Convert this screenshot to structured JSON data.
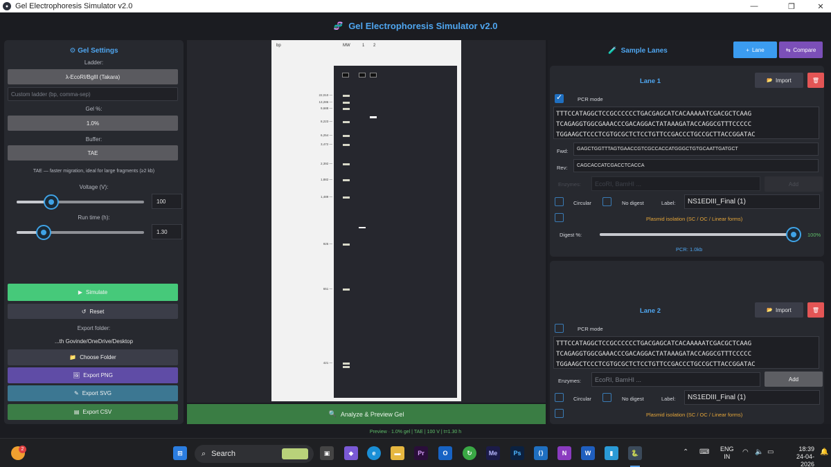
{
  "window": {
    "title": "Gel Electrophoresis Simulator v2.0",
    "minimize": "—",
    "maximize": "❐",
    "close": "✕"
  },
  "header": {
    "icon": "🧬",
    "title": "Gel Electrophoresis Simulator  v2.0"
  },
  "settings": {
    "icon": "⚙",
    "title": "Gel Settings",
    "ladder_label": "Ladder:",
    "ladder_value": "λ-EcoRI/BglII (Takara)",
    "custom_ladder_placeholder": "Custom ladder (bp, comma-sep)",
    "gel_label": "Gel %:",
    "gel_value": "1.0%",
    "buffer_label": "Buffer:",
    "buffer_value": "TAE",
    "buffer_note": "TAE — faster migration, ideal for large fragments (≥2 kb)",
    "voltage_label": "Voltage (V):",
    "voltage_value": "100",
    "voltage_level": 0.27,
    "runtime_label": "Run time (h):",
    "runtime_value": "1.30",
    "runtime_level": 0.21,
    "simulate_label": "Simulate",
    "reset_label": "Reset",
    "export_folder_label": "Export folder:",
    "export_folder_value": "...th Govinde/OneDrive/Desktop",
    "choose_folder_label": "Choose Folder",
    "export_png_label": "Export PNG",
    "export_svg_label": "Export SVG",
    "export_csv_label": "Export CSV",
    "icons": {
      "simulate": "▶",
      "reset": "↺",
      "folder": "📁",
      "png": "🖼",
      "svg": "✎",
      "csv": "▤"
    }
  },
  "gel": {
    "bp_label": "bp",
    "mw_label": "MW",
    "lane_numbers": [
      "1",
      "2"
    ],
    "ladder_bands": [
      {
        "label": "22,010"
      },
      {
        "label": "13,286"
      },
      {
        "label": "9,688"
      },
      {
        "label": "8,223"
      },
      {
        "label": "6,254"
      },
      {
        "label": "3,472"
      },
      {
        "label": "2,392"
      },
      {
        "label": "1,882"
      },
      {
        "label": "1,489"
      },
      {
        "label": "925"
      },
      {
        "label": "651"
      },
      {
        "label": "421"
      }
    ],
    "analyze_label": "Analyze & Preview Gel",
    "analyze_icon": "🔍"
  },
  "lanes_panel": {
    "icon": "🧪",
    "title": "Sample Lanes",
    "lane_button": "Lane",
    "compare_button": "Compare",
    "lane_button_icon": "+",
    "compare_button_icon": "⇆",
    "lane_button_color": "#3b9cf0",
    "compare_button_color": "#7b4fb8"
  },
  "lanes": [
    {
      "title": "Lane 1",
      "import_label": "Import",
      "import_icon": "📂",
      "delete_icon": "🗑",
      "pcr_mode_label": "PCR mode",
      "pcr_mode_checked": true,
      "sequence_lines": [
        "TTTCCATAGGCTCCGCCCCCCTGACGAGCATCACAAAAATCGACGCTCAAG",
        "TCAGAGGTGGCGAAACCCGACAGGACTATAAAGATACCAGGCGTTTCCCCC",
        "TGGAAGCTCCCTCGTGCGCTCTCCTGTTCCGACCCTGCCGCTTACCGGATAC"
      ],
      "fwd_label": "Fwd:",
      "fwd_value": "GAGCTGGTTTAGTGAACCGTCGCCACCATGGGCTGTGCAATTGATGCT",
      "rev_label": "Rev:",
      "rev_value": "CAGCACCATCGACCTCACCA",
      "enzymes_label": "Enzymes:",
      "enzymes_placeholder": "EcoRI, BamHI ...",
      "add_label": "Add",
      "circular_label": "Circular",
      "nodigest_label": "No digest",
      "label_label": "Label:",
      "label_value": "NS1EDIII_Final (1)",
      "plasmid_label": "Plasmid isolation (SC / OC / Linear forms)",
      "digest_label": "Digest %:",
      "digest_value": "100%",
      "digest_level": 1.0,
      "pcr_result": "PCR: 1.0kb"
    },
    {
      "title": "Lane 2",
      "import_label": "Import",
      "pcr_mode_label": "PCR mode",
      "pcr_mode_checked": false,
      "sequence_lines": [
        "TTTCCATAGGCTCCGCCCCCCTGACGAGCATCACAAAAATCGACGCTCAAG",
        "TCAGAGGTGGCGAAACCCGACAGGACTATAAAGATACCAGGCGTTTCCCCC",
        "TGGAAGCTCCCTCGTGCGCTCTCCTGTTCCGACCCTGCCGCTTACCGGATAC"
      ],
      "enzymes_label": "Enzymes:",
      "enzymes_placeholder": "EcoRI, BamHI ...",
      "add_label": "Add",
      "circular_label": "Circular",
      "nodigest_label": "No digest",
      "label_label": "Label:",
      "label_value": "NS1EDIII_Final (1)",
      "plasmid_label": "Plasmid isolation (SC / OC / Linear forms)"
    }
  ],
  "status": "Preview  ·  1.0% gel  |  TAE  |  100 V  |  t=1.30 h",
  "taskbar": {
    "search_label": "Search",
    "notification_badge": "2",
    "lang_top": "ENG",
    "lang_bottom": "IN",
    "time": "18:39",
    "date": "24-04-2026"
  }
}
